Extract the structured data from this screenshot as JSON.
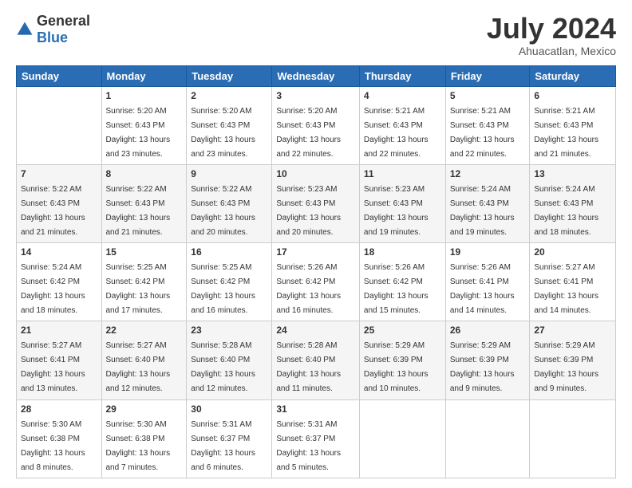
{
  "logo": {
    "general": "General",
    "blue": "Blue"
  },
  "title": "July 2024",
  "location": "Ahuacatlan, Mexico",
  "days_header": [
    "Sunday",
    "Monday",
    "Tuesday",
    "Wednesday",
    "Thursday",
    "Friday",
    "Saturday"
  ],
  "weeks": [
    [
      {
        "day": "",
        "sunrise": "",
        "sunset": "",
        "daylight": ""
      },
      {
        "day": "1",
        "sunrise": "Sunrise: 5:20 AM",
        "sunset": "Sunset: 6:43 PM",
        "daylight": "Daylight: 13 hours and 23 minutes."
      },
      {
        "day": "2",
        "sunrise": "Sunrise: 5:20 AM",
        "sunset": "Sunset: 6:43 PM",
        "daylight": "Daylight: 13 hours and 23 minutes."
      },
      {
        "day": "3",
        "sunrise": "Sunrise: 5:20 AM",
        "sunset": "Sunset: 6:43 PM",
        "daylight": "Daylight: 13 hours and 22 minutes."
      },
      {
        "day": "4",
        "sunrise": "Sunrise: 5:21 AM",
        "sunset": "Sunset: 6:43 PM",
        "daylight": "Daylight: 13 hours and 22 minutes."
      },
      {
        "day": "5",
        "sunrise": "Sunrise: 5:21 AM",
        "sunset": "Sunset: 6:43 PM",
        "daylight": "Daylight: 13 hours and 22 minutes."
      },
      {
        "day": "6",
        "sunrise": "Sunrise: 5:21 AM",
        "sunset": "Sunset: 6:43 PM",
        "daylight": "Daylight: 13 hours and 21 minutes."
      }
    ],
    [
      {
        "day": "7",
        "sunrise": "Sunrise: 5:22 AM",
        "sunset": "Sunset: 6:43 PM",
        "daylight": "Daylight: 13 hours and 21 minutes."
      },
      {
        "day": "8",
        "sunrise": "Sunrise: 5:22 AM",
        "sunset": "Sunset: 6:43 PM",
        "daylight": "Daylight: 13 hours and 21 minutes."
      },
      {
        "day": "9",
        "sunrise": "Sunrise: 5:22 AM",
        "sunset": "Sunset: 6:43 PM",
        "daylight": "Daylight: 13 hours and 20 minutes."
      },
      {
        "day": "10",
        "sunrise": "Sunrise: 5:23 AM",
        "sunset": "Sunset: 6:43 PM",
        "daylight": "Daylight: 13 hours and 20 minutes."
      },
      {
        "day": "11",
        "sunrise": "Sunrise: 5:23 AM",
        "sunset": "Sunset: 6:43 PM",
        "daylight": "Daylight: 13 hours and 19 minutes."
      },
      {
        "day": "12",
        "sunrise": "Sunrise: 5:24 AM",
        "sunset": "Sunset: 6:43 PM",
        "daylight": "Daylight: 13 hours and 19 minutes."
      },
      {
        "day": "13",
        "sunrise": "Sunrise: 5:24 AM",
        "sunset": "Sunset: 6:43 PM",
        "daylight": "Daylight: 13 hours and 18 minutes."
      }
    ],
    [
      {
        "day": "14",
        "sunrise": "Sunrise: 5:24 AM",
        "sunset": "Sunset: 6:42 PM",
        "daylight": "Daylight: 13 hours and 18 minutes."
      },
      {
        "day": "15",
        "sunrise": "Sunrise: 5:25 AM",
        "sunset": "Sunset: 6:42 PM",
        "daylight": "Daylight: 13 hours and 17 minutes."
      },
      {
        "day": "16",
        "sunrise": "Sunrise: 5:25 AM",
        "sunset": "Sunset: 6:42 PM",
        "daylight": "Daylight: 13 hours and 16 minutes."
      },
      {
        "day": "17",
        "sunrise": "Sunrise: 5:26 AM",
        "sunset": "Sunset: 6:42 PM",
        "daylight": "Daylight: 13 hours and 16 minutes."
      },
      {
        "day": "18",
        "sunrise": "Sunrise: 5:26 AM",
        "sunset": "Sunset: 6:42 PM",
        "daylight": "Daylight: 13 hours and 15 minutes."
      },
      {
        "day": "19",
        "sunrise": "Sunrise: 5:26 AM",
        "sunset": "Sunset: 6:41 PM",
        "daylight": "Daylight: 13 hours and 14 minutes."
      },
      {
        "day": "20",
        "sunrise": "Sunrise: 5:27 AM",
        "sunset": "Sunset: 6:41 PM",
        "daylight": "Daylight: 13 hours and 14 minutes."
      }
    ],
    [
      {
        "day": "21",
        "sunrise": "Sunrise: 5:27 AM",
        "sunset": "Sunset: 6:41 PM",
        "daylight": "Daylight: 13 hours and 13 minutes."
      },
      {
        "day": "22",
        "sunrise": "Sunrise: 5:27 AM",
        "sunset": "Sunset: 6:40 PM",
        "daylight": "Daylight: 13 hours and 12 minutes."
      },
      {
        "day": "23",
        "sunrise": "Sunrise: 5:28 AM",
        "sunset": "Sunset: 6:40 PM",
        "daylight": "Daylight: 13 hours and 12 minutes."
      },
      {
        "day": "24",
        "sunrise": "Sunrise: 5:28 AM",
        "sunset": "Sunset: 6:40 PM",
        "daylight": "Daylight: 13 hours and 11 minutes."
      },
      {
        "day": "25",
        "sunrise": "Sunrise: 5:29 AM",
        "sunset": "Sunset: 6:39 PM",
        "daylight": "Daylight: 13 hours and 10 minutes."
      },
      {
        "day": "26",
        "sunrise": "Sunrise: 5:29 AM",
        "sunset": "Sunset: 6:39 PM",
        "daylight": "Daylight: 13 hours and 9 minutes."
      },
      {
        "day": "27",
        "sunrise": "Sunrise: 5:29 AM",
        "sunset": "Sunset: 6:39 PM",
        "daylight": "Daylight: 13 hours and 9 minutes."
      }
    ],
    [
      {
        "day": "28",
        "sunrise": "Sunrise: 5:30 AM",
        "sunset": "Sunset: 6:38 PM",
        "daylight": "Daylight: 13 hours and 8 minutes."
      },
      {
        "day": "29",
        "sunrise": "Sunrise: 5:30 AM",
        "sunset": "Sunset: 6:38 PM",
        "daylight": "Daylight: 13 hours and 7 minutes."
      },
      {
        "day": "30",
        "sunrise": "Sunrise: 5:31 AM",
        "sunset": "Sunset: 6:37 PM",
        "daylight": "Daylight: 13 hours and 6 minutes."
      },
      {
        "day": "31",
        "sunrise": "Sunrise: 5:31 AM",
        "sunset": "Sunset: 6:37 PM",
        "daylight": "Daylight: 13 hours and 5 minutes."
      },
      {
        "day": "",
        "sunrise": "",
        "sunset": "",
        "daylight": ""
      },
      {
        "day": "",
        "sunrise": "",
        "sunset": "",
        "daylight": ""
      },
      {
        "day": "",
        "sunrise": "",
        "sunset": "",
        "daylight": ""
      }
    ]
  ]
}
